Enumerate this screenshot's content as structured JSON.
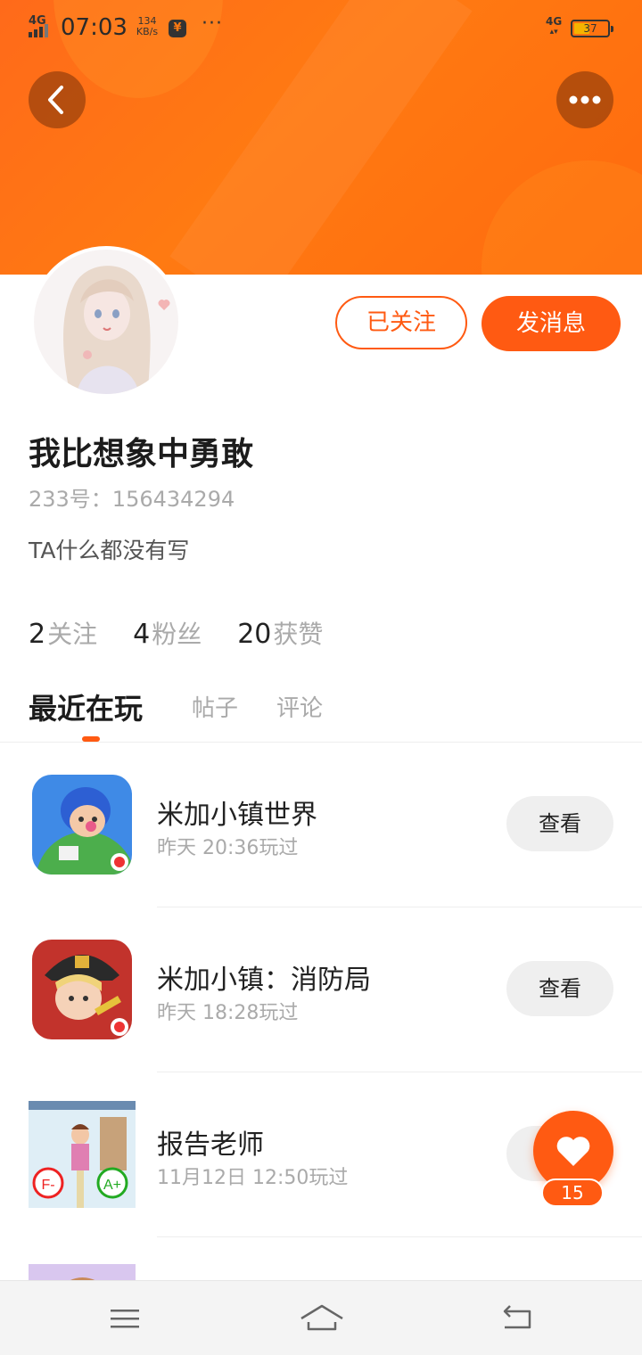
{
  "status_bar": {
    "network_left": "4G",
    "time": "07:03",
    "speed_value": "134",
    "speed_unit": "KB/s",
    "yen_symbol": "¥",
    "more": "···",
    "network_right": "4G",
    "battery_level": "37"
  },
  "header": {
    "back_icon": "chevron-left-icon",
    "more_icon": "more-dots-icon"
  },
  "profile": {
    "username": "我比想象中勇敢",
    "id_text": "233号：156434294",
    "bio": "TA什么都没有写",
    "follow_label": "已关注",
    "message_label": "发消息",
    "stats": [
      {
        "count": "2",
        "label": "关注"
      },
      {
        "count": "4",
        "label": "粉丝"
      },
      {
        "count": "20",
        "label": "获赞"
      }
    ]
  },
  "tabs": [
    {
      "label": "最近在玩",
      "active": true
    },
    {
      "label": "帖子",
      "active": false
    },
    {
      "label": "评论",
      "active": false
    }
  ],
  "games": [
    {
      "title": "米加小镇世界",
      "played": "昨天 20:36玩过",
      "action": "查看"
    },
    {
      "title": "米加小镇：消防局",
      "played": "昨天 18:28玩过",
      "action": "查看"
    },
    {
      "title": "报告老师",
      "played": "11月12日 12:50玩过",
      "action": "查看"
    }
  ],
  "like_fab": {
    "icon": "heart-icon",
    "count": "15"
  },
  "game3_icon_text": {
    "fail": "F-",
    "pass": "A+"
  },
  "colors": {
    "accent": "#ff5a12",
    "header_gradient": "#ff7a12"
  },
  "nav_bar": {
    "menu_icon": "menu-icon",
    "home_icon": "home-icon",
    "back_icon": "back-arrow-icon"
  }
}
